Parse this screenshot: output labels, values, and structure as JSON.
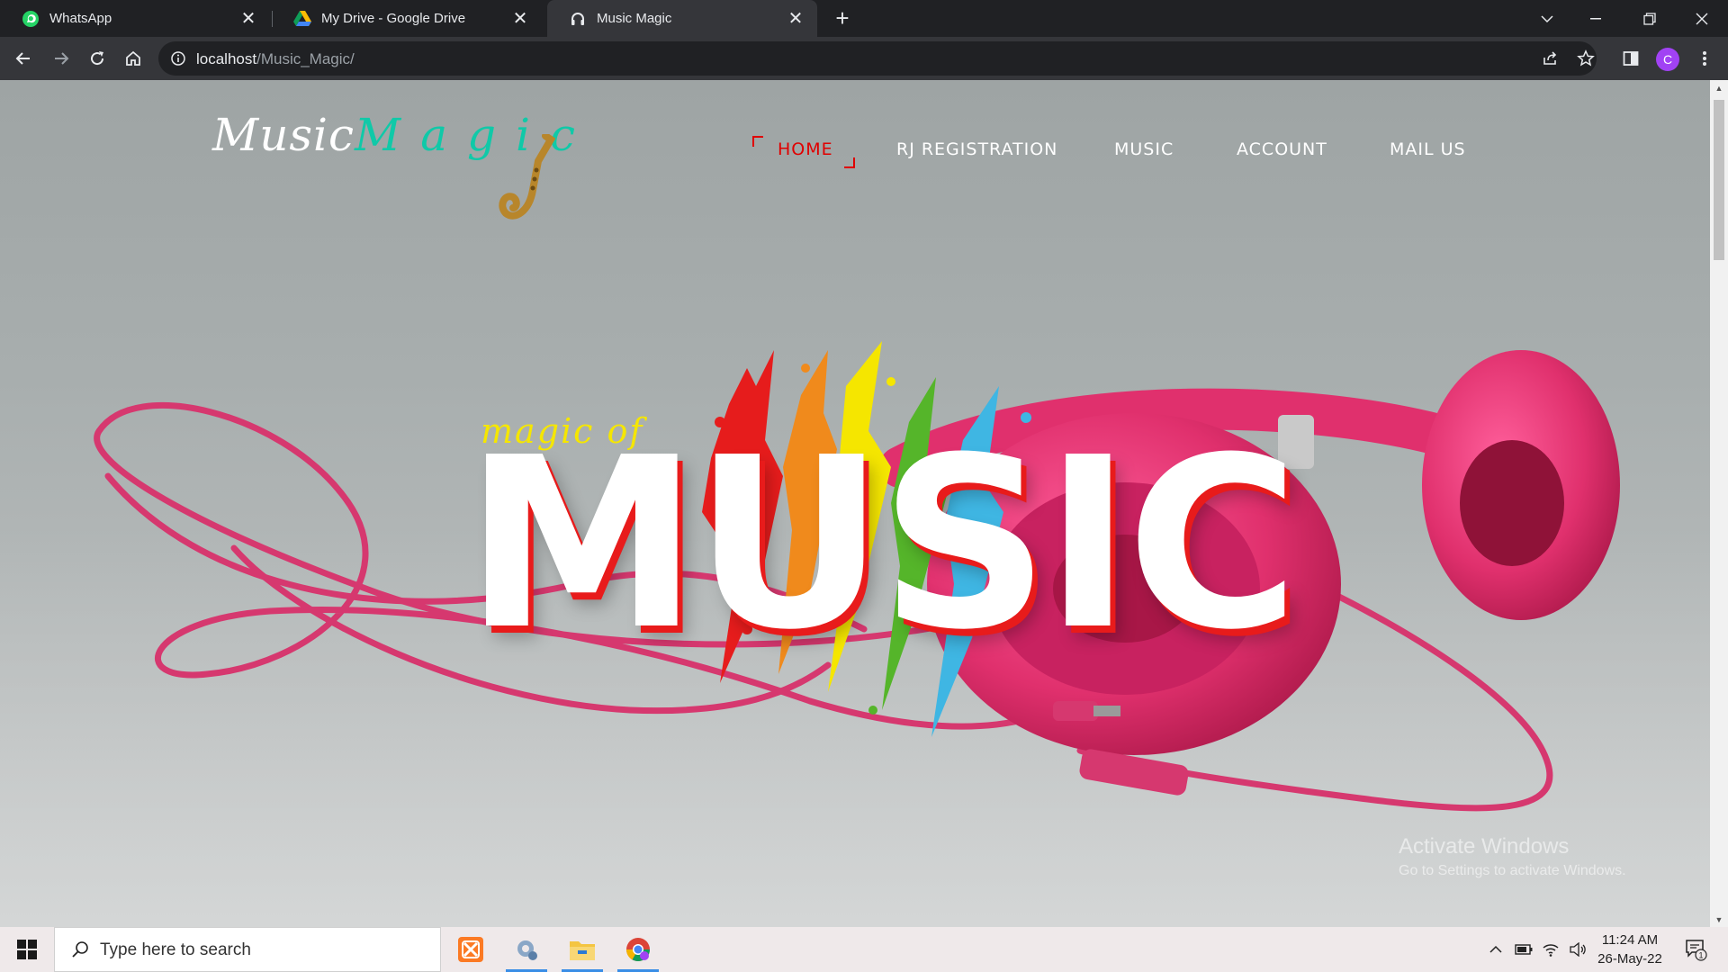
{
  "browser": {
    "tabs": [
      {
        "title": "WhatsApp",
        "favicon": "whatsapp-icon"
      },
      {
        "title": "My Drive - Google Drive",
        "favicon": "google-drive-icon"
      },
      {
        "title": "Music Magic",
        "favicon": "headphones-icon",
        "active": true
      }
    ],
    "address": {
      "host": "localhost",
      "path": "/Music_Magic/"
    },
    "profile_initial": "C"
  },
  "site": {
    "logo": {
      "part1": "Music",
      "part2": "Magic"
    },
    "nav": [
      {
        "label": "HOME",
        "active": true
      },
      {
        "label": "RJ REGISTRATION"
      },
      {
        "label": "MUSIC"
      },
      {
        "label": "ACCOUNT"
      },
      {
        "label": "MAIL US"
      }
    ],
    "hero": {
      "script_text": "magic of",
      "headline": "MUSIC"
    },
    "colors": {
      "accent": "#e00000",
      "headline": "#ffffff",
      "script": "#f5e600",
      "logo_magic": "#10c9a8"
    }
  },
  "os_watermark": {
    "title": "Activate Windows",
    "subtitle": "Go to Settings to activate Windows."
  },
  "taskbar": {
    "search_placeholder": "Type here to search",
    "apps": [
      "xampp-icon",
      "settings-gear-icon",
      "file-explorer-icon",
      "chrome-icon"
    ],
    "time": "11:24 AM",
    "date": "26-May-22",
    "notification_count": "1"
  }
}
